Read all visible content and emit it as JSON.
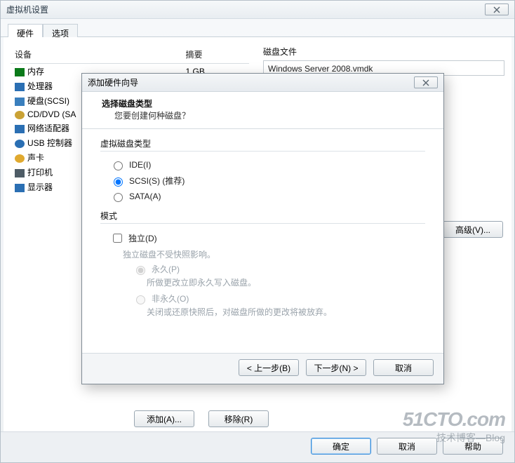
{
  "settings": {
    "title": "虚拟机设置",
    "tabs": {
      "hardware": "硬件",
      "options": "选项"
    },
    "columns": {
      "device": "设备",
      "summary": "摘要"
    },
    "rows": [
      {
        "icon": "memory-icon",
        "cls": "ic-mem",
        "name": "内存",
        "summary": "1 GB"
      },
      {
        "icon": "cpu-icon",
        "cls": "ic-cpu",
        "name": "处理器",
        "summary": ""
      },
      {
        "icon": "hdd-icon",
        "cls": "ic-hdd",
        "name": "硬盘(SCSI)",
        "summary": ""
      },
      {
        "icon": "cd-icon",
        "cls": "ic-cd",
        "name": "CD/DVD (SA",
        "summary": ""
      },
      {
        "icon": "nic-icon",
        "cls": "ic-net",
        "name": "网络适配器",
        "summary": ""
      },
      {
        "icon": "usb-icon",
        "cls": "ic-usb",
        "name": "USB 控制器",
        "summary": ""
      },
      {
        "icon": "sound-icon",
        "cls": "ic-snd",
        "name": "声卡",
        "summary": ""
      },
      {
        "icon": "printer-icon",
        "cls": "ic-prn",
        "name": "打印机",
        "summary": ""
      },
      {
        "icon": "display-icon",
        "cls": "ic-dsp",
        "name": "显示器",
        "summary": ""
      }
    ],
    "right": {
      "diskfile_label": "磁盘文件",
      "diskfile_value": "Windows Server 2008.vmdk",
      "advanced_btn": "高级(V)..."
    },
    "list_buttons": {
      "add": "添加(A)...",
      "remove": "移除(R)"
    },
    "footer": {
      "ok": "确定",
      "cancel": "取消",
      "help": "帮助"
    }
  },
  "wizard": {
    "title": "添加硬件向导",
    "heading": "选择磁盘类型",
    "subheading": "您要创建何种磁盘？",
    "group_vtype": "虚拟磁盘类型",
    "opt_ide": "IDE(I)",
    "opt_scsi": "SCSI(S)   (推荐)",
    "opt_sata": "SATA(A)",
    "group_mode": "模式",
    "chk_independent": "独立(D)",
    "independent_note": "独立磁盘不受快照影响。",
    "opt_persist": "永久(P)",
    "persist_hint": "所做更改立即永久写入磁盘。",
    "opt_nonpersist": "非永久(O)",
    "nonpersist_hint": "关闭或还原快照后，对磁盘所做的更改将被放弃。",
    "footer": {
      "back": "< 上一步(B)",
      "next": "下一步(N) >",
      "cancel": "取消"
    }
  },
  "watermark": {
    "brand": "51CTO.com",
    "tag": "技术博客—Blog"
  }
}
